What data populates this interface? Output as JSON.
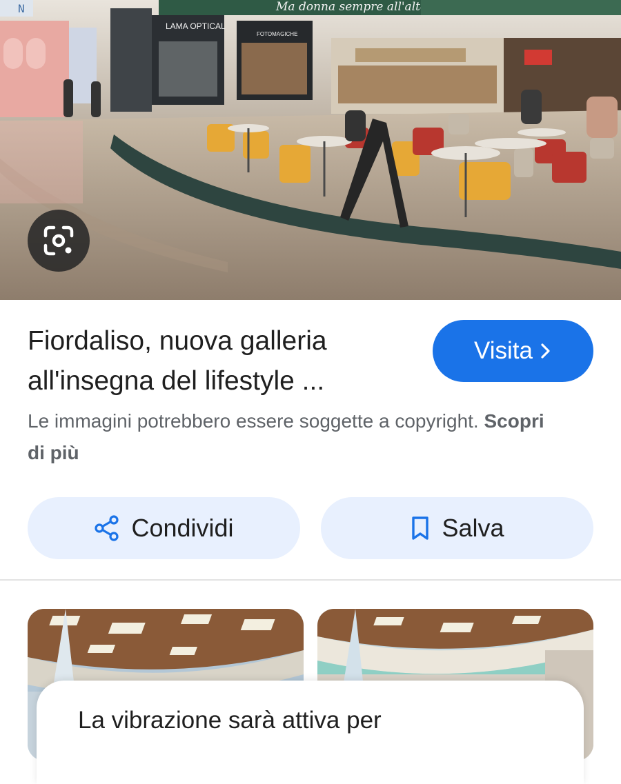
{
  "result": {
    "title_line1": "Fiordaliso, nuova galleria",
    "title_line2": "all'insegna del lifestyle ...",
    "visit_label": "Visita",
    "copyright_text": "Le immagini potrebbero essere soggette a copyright.",
    "learn_more_label": "Scopri di più"
  },
  "hero_photo": {
    "banner_text": "Ma donna sempre all'altezza.",
    "store_left_sign": "N",
    "store_sign_1": "LAMA OPTICAL",
    "store_sign_2": "FOTOMAGICHE"
  },
  "actions": {
    "share_label": "Condividi",
    "save_label": "Salva"
  },
  "toast": {
    "message": "La vibrazione sarà attiva per"
  },
  "colors": {
    "accent": "#1a73e8",
    "tonal_button": "#e8f0fe",
    "text_primary": "#1f1f1f",
    "text_secondary": "#5f6368"
  },
  "icons": {
    "lens": "google-lens-icon",
    "share": "share-icon",
    "save": "bookmark-icon",
    "visit": "chevron-right-icon"
  }
}
